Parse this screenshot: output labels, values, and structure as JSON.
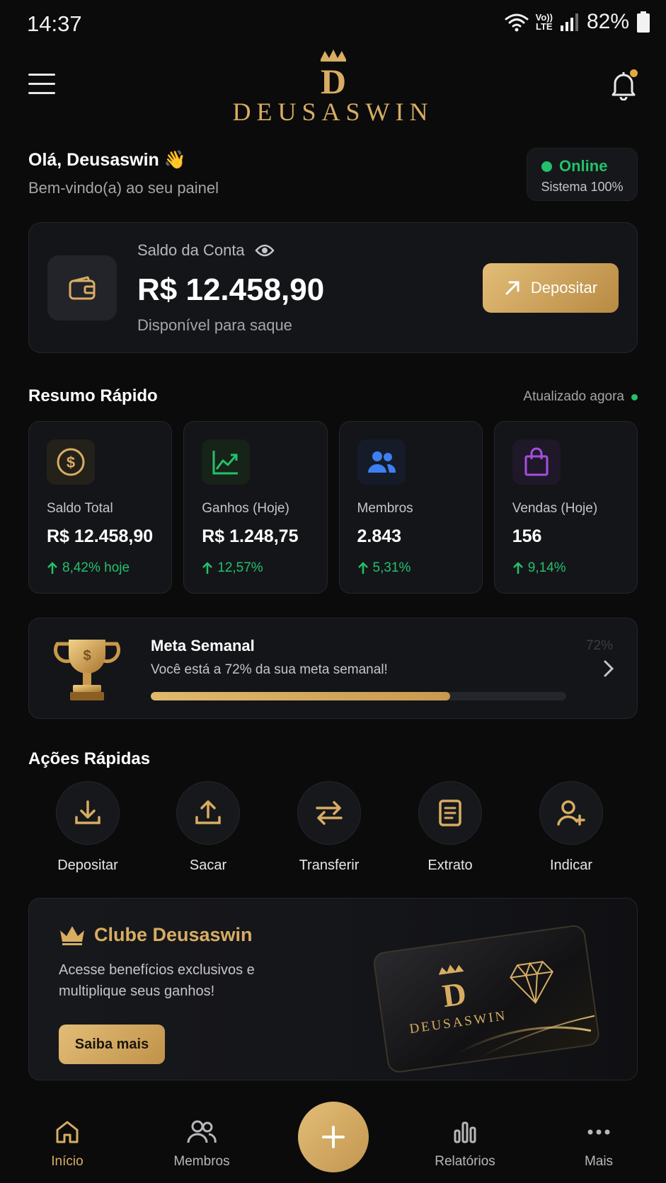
{
  "status_bar": {
    "time": "14:37",
    "network": "LTE",
    "volte": "Vo))",
    "battery": "82%"
  },
  "brand": {
    "name": "DEUSASWIN",
    "monogram": "D",
    "accent": "#d8ad62"
  },
  "greeting": {
    "hello": "Olá, Deusaswin 👋",
    "subtitle": "Bem-vindo(a) ao seu painel"
  },
  "system_status": {
    "label": "Online",
    "detail": "Sistema 100%",
    "color": "#23c16b"
  },
  "balance": {
    "title": "Saldo da Conta",
    "amount": "R$ 12.458,90",
    "caption": "Disponível para saque",
    "button": "Depositar"
  },
  "summary": {
    "title": "Resumo Rápido",
    "updated": "Atualizado agora",
    "cards": [
      {
        "icon": "dollar-coin-icon",
        "label": "Saldo Total",
        "value": "R$ 12.458,90",
        "change": "8,42% hoje",
        "color": "#d8ad62"
      },
      {
        "icon": "trend-up-icon",
        "label": "Ganhos (Hoje)",
        "value": "R$ 1.248,75",
        "change": "12,57%",
        "color": "#23c16b"
      },
      {
        "icon": "members-icon",
        "label": "Membros",
        "value": "2.843",
        "change": "5,31%",
        "color": "#3d7ff0"
      },
      {
        "icon": "shopping-bag-icon",
        "label": "Vendas (Hoje)",
        "value": "156",
        "change": "9,14%",
        "color": "#a44fe0"
      }
    ]
  },
  "weekly_goal": {
    "title": "Meta Semanal",
    "description": "Você está a 72% da sua meta semanal!",
    "percent_label": "72%",
    "progress": 0.72
  },
  "quick_actions": {
    "title": "Ações Rápidas",
    "items": [
      {
        "icon": "download-icon",
        "label": "Depositar"
      },
      {
        "icon": "upload-icon",
        "label": "Sacar"
      },
      {
        "icon": "transfer-icon",
        "label": "Transferir"
      },
      {
        "icon": "statement-icon",
        "label": "Extrato"
      },
      {
        "icon": "add-user-icon",
        "label": "Indicar"
      }
    ]
  },
  "club": {
    "title": "Clube Deusaswin",
    "description": "Acesse benefícios exclusivos e multiplique seus ganhos!",
    "button": "Saiba mais",
    "card_brand": "DEUSASWIN"
  },
  "bottom_nav": {
    "items": [
      {
        "icon": "home-icon",
        "label": "Início",
        "active": true
      },
      {
        "icon": "members-icon",
        "label": "Membros",
        "active": false
      },
      {
        "icon": "plus-icon",
        "label": "",
        "active": false
      },
      {
        "icon": "bar-chart-icon",
        "label": "Relatórios",
        "active": false
      },
      {
        "icon": "more-icon",
        "label": "Mais",
        "active": false
      }
    ]
  }
}
